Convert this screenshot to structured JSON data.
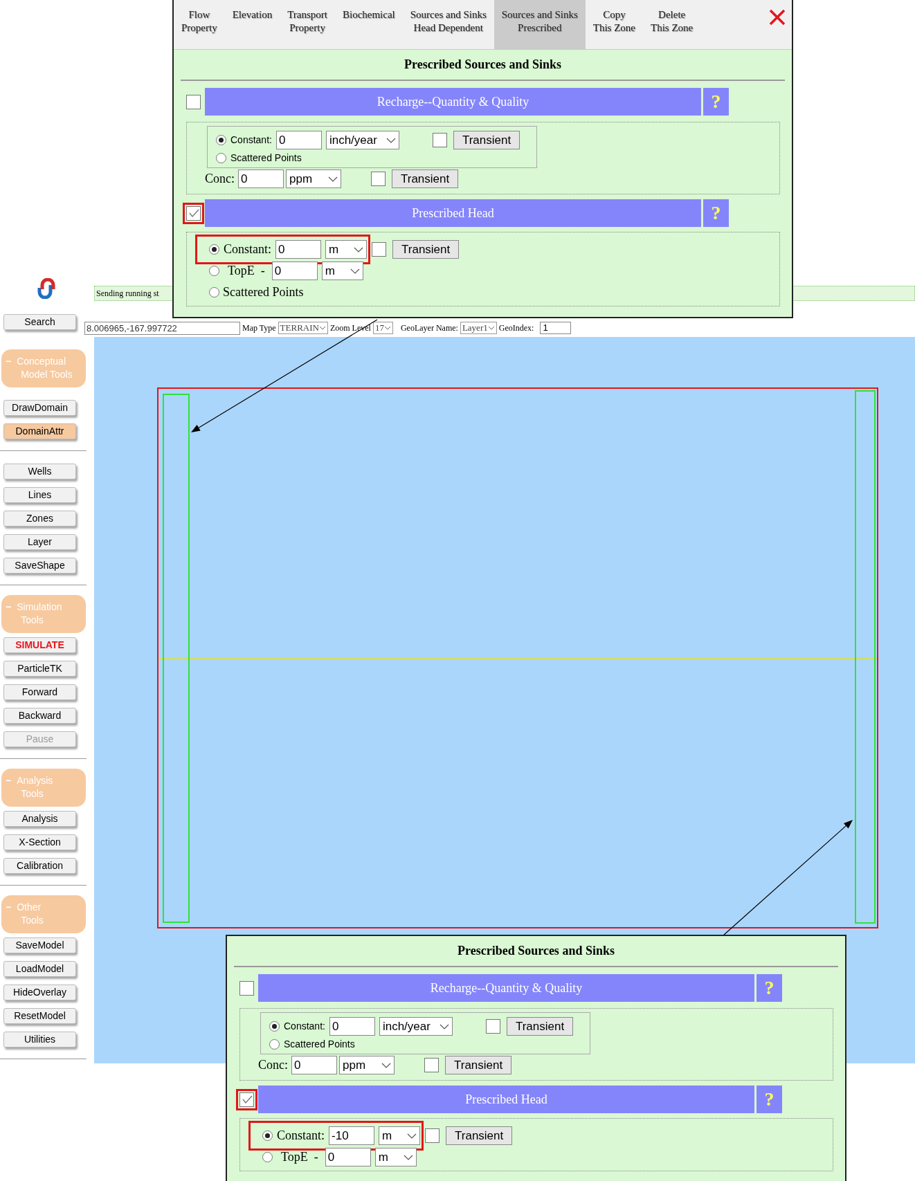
{
  "sidebar": {
    "search": "Search",
    "groups": [
      {
        "toggle": "−",
        "title_lines": [
          "Conceptual",
          "Model Tools"
        ],
        "sections": [
          [
            {
              "label": "DrawDomain",
              "kind": "normal",
              "selected": false,
              "disabled": false
            },
            {
              "label": "DomainAttr",
              "kind": "normal",
              "selected": true,
              "disabled": false
            }
          ],
          [
            {
              "label": "Wells",
              "kind": "normal",
              "selected": false,
              "disabled": false
            },
            {
              "label": "Lines",
              "kind": "normal",
              "selected": false,
              "disabled": false
            },
            {
              "label": "Zones",
              "kind": "normal",
              "selected": false,
              "disabled": false
            },
            {
              "label": "Layer",
              "kind": "normal",
              "selected": false,
              "disabled": false
            },
            {
              "label": "SaveShape",
              "kind": "normal",
              "selected": false,
              "disabled": false
            }
          ]
        ]
      },
      {
        "toggle": "−",
        "title_lines": [
          "Simulation",
          "Tools"
        ],
        "sections": [
          [
            {
              "label": "SIMULATE",
              "kind": "alert",
              "selected": false,
              "disabled": false
            },
            {
              "label": "ParticleTK",
              "kind": "normal",
              "selected": false,
              "disabled": false
            },
            {
              "label": "Forward",
              "kind": "normal",
              "selected": false,
              "disabled": false
            },
            {
              "label": "Backward",
              "kind": "normal",
              "selected": false,
              "disabled": false
            },
            {
              "label": "Pause",
              "kind": "normal",
              "selected": false,
              "disabled": true
            }
          ]
        ]
      },
      {
        "toggle": "−",
        "title_lines": [
          "Analysis",
          "Tools"
        ],
        "sections": [
          [
            {
              "label": "Analysis",
              "kind": "normal",
              "selected": false,
              "disabled": false
            },
            {
              "label": "X-Section",
              "kind": "normal",
              "selected": false,
              "disabled": false
            },
            {
              "label": "Calibration",
              "kind": "normal",
              "selected": false,
              "disabled": false
            }
          ]
        ]
      },
      {
        "toggle": "−",
        "title_lines": [
          "Other",
          "Tools"
        ],
        "sections": [
          [
            {
              "label": "SaveModel",
              "kind": "normal",
              "selected": false,
              "disabled": false
            },
            {
              "label": "LoadModel",
              "kind": "normal",
              "selected": false,
              "disabled": false
            },
            {
              "label": "HideOverlay",
              "kind": "normal",
              "selected": false,
              "disabled": false
            },
            {
              "label": "ResetModel",
              "kind": "normal",
              "selected": false,
              "disabled": false
            },
            {
              "label": "Utilities",
              "kind": "normal",
              "selected": false,
              "disabled": false
            }
          ]
        ]
      }
    ]
  },
  "status_bar": "Sending running st",
  "toolbar": {
    "coordinates": "8.006965,-167.997722",
    "map_type_label": "Map Type",
    "map_type": "TERRAIN",
    "zoom_label": "Zoom Level",
    "zoom": "17",
    "geolayer_label": "GeoLayer Name:",
    "geolayer": "Layer1",
    "geoindex_label": "GeoIndex:",
    "geoindex": "1"
  },
  "panels": [
    {
      "tabs": [
        {
          "lines": [
            "Flow",
            "Property"
          ],
          "selected": false
        },
        {
          "lines": [
            "Elevation"
          ],
          "selected": false
        },
        {
          "lines": [
            "Transport",
            "Property"
          ],
          "selected": false
        },
        {
          "lines": [
            "Biochemical"
          ],
          "selected": false
        },
        {
          "lines": [
            "Sources and Sinks",
            "Head Dependent"
          ],
          "selected": false
        },
        {
          "lines": [
            "Sources and Sinks",
            "Prescribed"
          ],
          "selected": true
        },
        {
          "lines": [
            "Copy",
            "This Zone"
          ],
          "selected": false
        },
        {
          "lines": [
            "Delete",
            "This Zone"
          ],
          "selected": false
        }
      ],
      "heading": "Prescribed Sources and Sinks",
      "recharge": {
        "title": "Recharge--Quantity & Quality",
        "checked": false,
        "highlighted": false,
        "help": "?",
        "constant": {
          "label": "Constant:",
          "selected": true,
          "value": "0",
          "unit": "inch/year",
          "transient": "Transient",
          "transient_checked": false
        },
        "scattered": {
          "label": "Scattered Points",
          "selected": false
        },
        "conc": {
          "label": "Conc:",
          "value": "0",
          "unit": "ppm",
          "transient": "Transient",
          "transient_checked": false
        }
      },
      "head": {
        "title": "Prescribed Head",
        "checked": true,
        "highlighted": true,
        "help": "?",
        "constant": {
          "label": "Constant:",
          "selected": true,
          "value": "0",
          "unit": "m",
          "transient": "Transient",
          "transient_checked": false,
          "highlighted": true
        },
        "tope": {
          "label": "TopE  -",
          "selected": false,
          "value": "0",
          "unit": "m"
        },
        "scattered": {
          "label": "Scattered Points",
          "selected": false
        }
      }
    },
    {
      "heading": "Prescribed Sources and Sinks",
      "recharge": {
        "title": "Recharge--Quantity & Quality",
        "checked": false,
        "highlighted": false,
        "help": "?",
        "constant": {
          "label": "Constant:",
          "selected": true,
          "value": "0",
          "unit": "inch/year",
          "transient": "Transient",
          "transient_checked": false
        },
        "scattered": {
          "label": "Scattered Points",
          "selected": false
        },
        "conc": {
          "label": "Conc:",
          "value": "0",
          "unit": "ppm",
          "transient": "Transient",
          "transient_checked": false
        }
      },
      "head": {
        "title": "Prescribed Head",
        "checked": true,
        "highlighted": true,
        "help": "?",
        "constant": {
          "label": "Constant:",
          "selected": true,
          "value": "-10",
          "unit": "m",
          "transient": "Transient",
          "transient_checked": false,
          "highlighted": true
        },
        "tope": {
          "label": "TopE  -",
          "selected": false,
          "value": "0",
          "unit": "m"
        }
      }
    }
  ]
}
